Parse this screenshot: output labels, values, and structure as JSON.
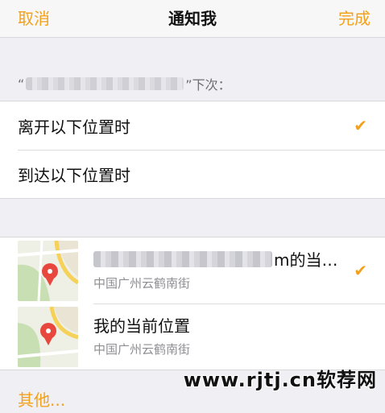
{
  "nav": {
    "cancel": "取消",
    "title": "通知我",
    "done": "完成"
  },
  "section": {
    "prefix": "“",
    "suffix": "”下次："
  },
  "triggers": [
    {
      "label": "离开以下位置时",
      "checked": true
    },
    {
      "label": "到达以下位置时",
      "checked": false
    }
  ],
  "locations": [
    {
      "title_visible": "m的当…",
      "subtitle": "中国广州云鹤南街",
      "checked": true
    },
    {
      "title_visible": "我的当前位置",
      "subtitle": "中国广州云鹤南街",
      "checked": false
    }
  ],
  "other_label": "其他...",
  "checkmark": "✔",
  "watermark": "www.rjtj.cn软荐网",
  "colors": {
    "accent": "#f3a11b",
    "background": "#efeff4"
  }
}
